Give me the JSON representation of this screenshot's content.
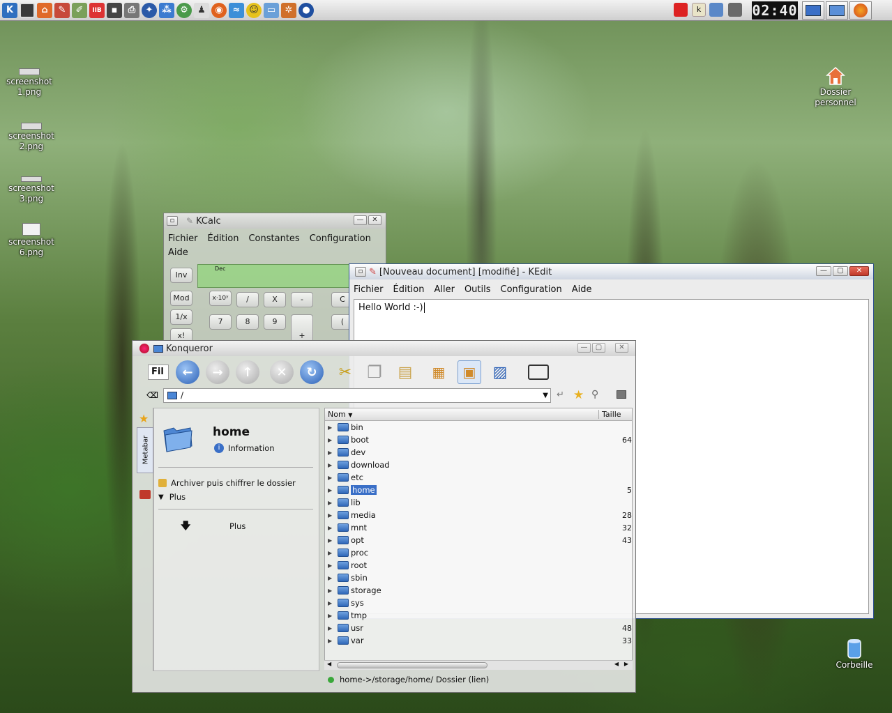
{
  "panel": {
    "clock": "02:40",
    "launchers": [
      "kde-menu",
      "desktop",
      "home",
      "office",
      "editor",
      "pim",
      "terminal",
      "printer",
      "compass",
      "network",
      "settings",
      "tux",
      "firefox",
      "dolphin",
      "chat",
      "window",
      "bug",
      "earth"
    ]
  },
  "desktop": {
    "icons": [
      {
        "label": "screenshot 1.png",
        "icon": "image-file-icon"
      },
      {
        "label": "screenshot 2.png",
        "icon": "image-file-icon"
      },
      {
        "label": "screenshot 3.png",
        "icon": "image-file-icon"
      },
      {
        "label": "screenshot 6.png",
        "icon": "image-file-icon"
      },
      {
        "label": "Dossier personnel",
        "icon": "home-folder-icon"
      },
      {
        "label": "Corbeille",
        "icon": "trash-icon"
      }
    ]
  },
  "kcalc": {
    "title": "KCalc",
    "menu": [
      "Fichier",
      "Édition",
      "Constantes",
      "Configuration",
      "Aide"
    ],
    "display_mode": "Dec",
    "keys": {
      "inv": "Inv",
      "mod": "Mod",
      "recip": "1/x",
      "fact": "x!",
      "exp": "x·10ʸ",
      "div": "/",
      "mul": "X",
      "minus": "-",
      "clear": "C",
      "seven": "7",
      "eight": "8",
      "nine": "9",
      "plus": "+",
      "paren": "("
    }
  },
  "kedit": {
    "title": "[Nouveau document] [modifié] - KEdit",
    "menu": [
      "Fichier",
      "Édition",
      "Aller",
      "Outils",
      "Configuration",
      "Aide"
    ],
    "text": "Hello World :-)"
  },
  "konqueror": {
    "title": "Konqueror",
    "toolbar_label": "Fil",
    "location": "/",
    "sidebar_tab": "Metabar",
    "metabar": {
      "folder_name": "home",
      "information": "Information",
      "action": "Archiver puis chiffrer le dossier",
      "more": "Plus",
      "more2": "Plus"
    },
    "columns": {
      "name": "Nom",
      "size": "Taille"
    },
    "files": [
      {
        "name": "bin",
        "size": ""
      },
      {
        "name": "boot",
        "size": "64"
      },
      {
        "name": "dev",
        "size": ""
      },
      {
        "name": "download",
        "size": ""
      },
      {
        "name": "etc",
        "size": ""
      },
      {
        "name": "home",
        "size": "5"
      },
      {
        "name": "lib",
        "size": ""
      },
      {
        "name": "media",
        "size": "28"
      },
      {
        "name": "mnt",
        "size": "32"
      },
      {
        "name": "opt",
        "size": "43"
      },
      {
        "name": "proc",
        "size": ""
      },
      {
        "name": "root",
        "size": ""
      },
      {
        "name": "sbin",
        "size": ""
      },
      {
        "name": "storage",
        "size": ""
      },
      {
        "name": "sys",
        "size": ""
      },
      {
        "name": "tmp",
        "size": ""
      },
      {
        "name": "usr",
        "size": "48"
      },
      {
        "name": "var",
        "size": "33"
      }
    ],
    "selected": "home",
    "status": "home->/storage/home/  Dossier (lien)"
  }
}
